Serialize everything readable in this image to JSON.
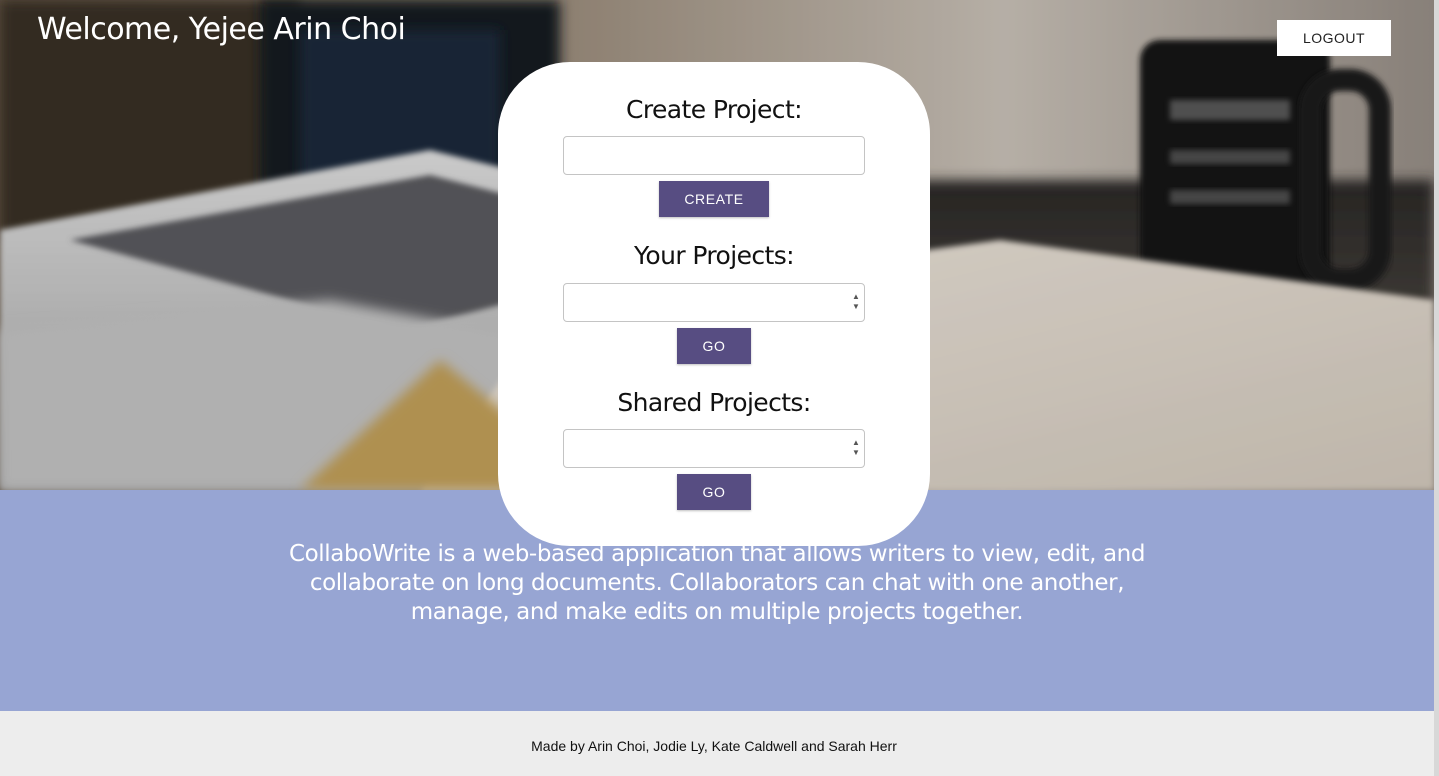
{
  "header": {
    "welcome_text": "Welcome, Yejee Arin Choi",
    "logout_label": "LOGOUT"
  },
  "create_project": {
    "title": "Create Project:",
    "input_value": "",
    "button_label": "CREATE"
  },
  "your_projects": {
    "title": "Your Projects:",
    "selected_value": "",
    "button_label": "GO"
  },
  "shared_projects": {
    "title": "Shared Projects:",
    "selected_value": "",
    "button_label": "GO"
  },
  "about": {
    "text": "CollaboWrite is a web-based application that allows writers to view, edit, and collaborate on long documents. Collaborators can chat with one another, manage, and make edits on multiple projects together."
  },
  "footer": {
    "credits": "Made by Arin Choi, Jodie Ly, Kate Caldwell and Sarah Herr"
  },
  "colors": {
    "accent_button": "#574d82",
    "about_background": "#97a5d3",
    "footer_background": "#ededed"
  },
  "icons": {
    "select_arrows": "up-down-arrows-icon"
  }
}
